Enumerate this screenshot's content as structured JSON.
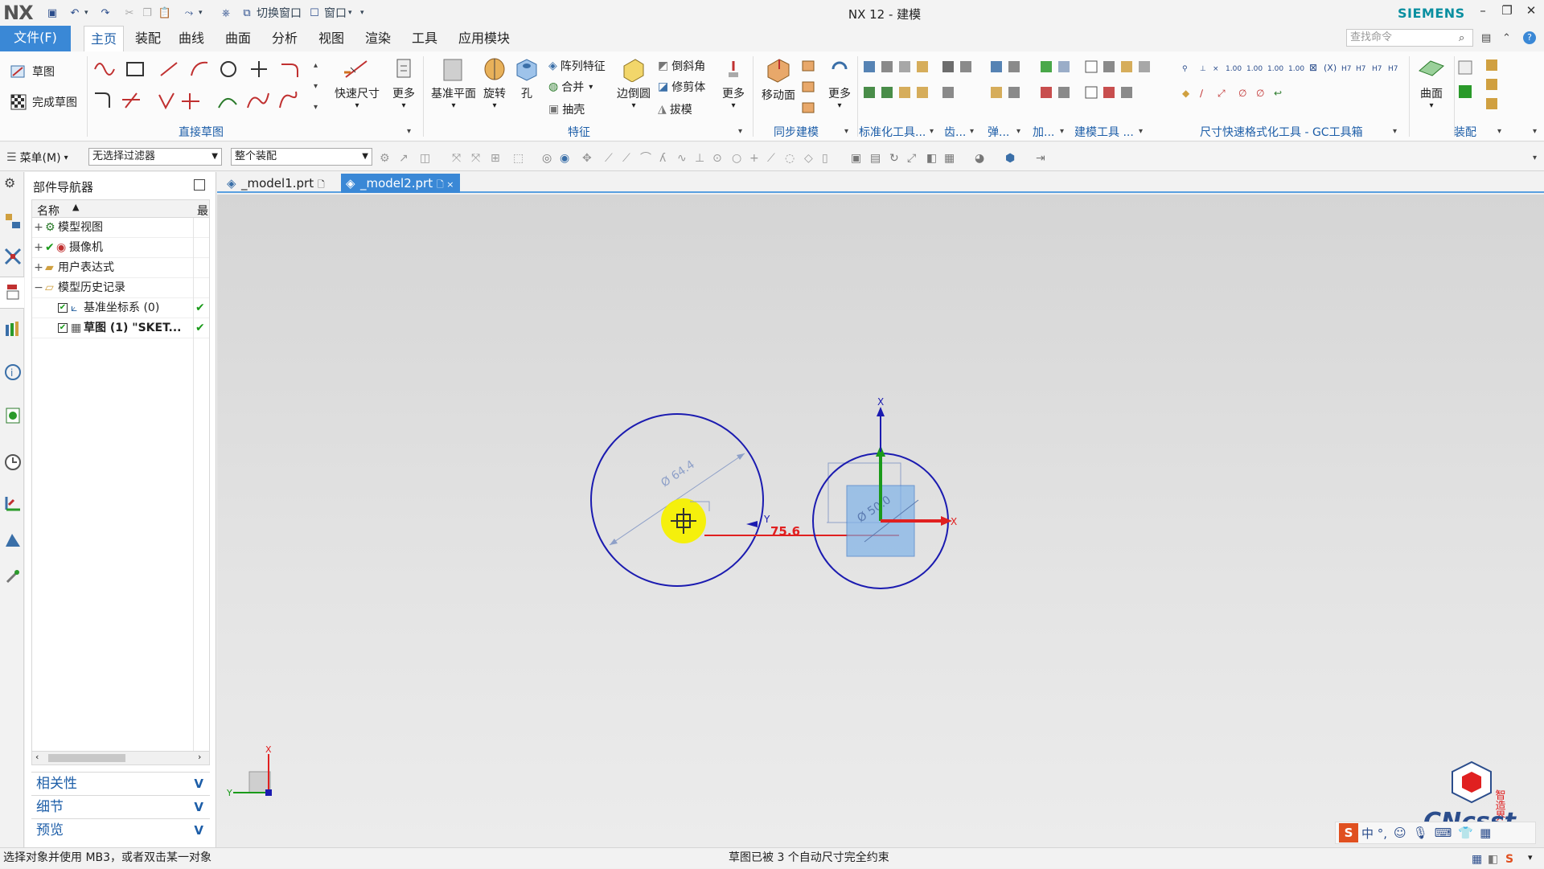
{
  "app": {
    "logo": "NX",
    "window_title": "NX 12 - 建模",
    "brand": "SIEMENS",
    "quick_access": {
      "switch_window": "切换窗口",
      "window": "窗口"
    }
  },
  "menu": {
    "file_label": "文件(F)",
    "tabs": [
      "主页",
      "装配",
      "曲线",
      "曲面",
      "分析",
      "视图",
      "渲染",
      "工具",
      "应用模块"
    ],
    "active_tab": "主页",
    "search_placeholder": "查找命令"
  },
  "ribbon": {
    "sketch": "草图",
    "finish_sketch": "完成草图",
    "quick_dim": "快速尺寸",
    "more": "更多",
    "direct_sketch_group": "直接草图",
    "datum_plane": "基准平面",
    "revolve": "旋转",
    "hole": "孔",
    "pattern_feature": "阵列特征",
    "unite": "合并",
    "shell": "抽壳",
    "edge_blend": "边倒圆",
    "chamfer": "倒斜角",
    "trim_body": "修剪体",
    "draft": "拔模",
    "more2": "更多",
    "feature_group": "特征",
    "move_face": "移动面",
    "more3": "更多",
    "sync_modeling_group": "同步建模",
    "standard_tools_group": "标准化工具...",
    "gear_group": "齿...",
    "spring_group": "弹...",
    "add_group": "加...",
    "modeling_tools_group": "建模工具 ...",
    "dim_format_group": "尺寸快速格式化工具 - GC工具箱",
    "surface": "曲面",
    "assembly_group": "装配"
  },
  "selection_bar": {
    "menu_label": "菜单(M)",
    "filter_value": "无选择过滤器",
    "scope_value": "整个装配"
  },
  "navigator": {
    "title": "部件导航器",
    "col_name": "名称",
    "col_last": "最",
    "rows": [
      {
        "label": "模型视图",
        "expander": "+",
        "checked": false
      },
      {
        "label": "摄像机",
        "expander": "+",
        "checked": false
      },
      {
        "label": "用户表达式",
        "expander": "+",
        "checked": false
      },
      {
        "label": "模型历史记录",
        "expander": "−",
        "checked": false
      },
      {
        "label": "基准坐标系 (0)",
        "expander": "",
        "checked": true
      },
      {
        "label": "草图 (1) \"SKET...",
        "expander": "",
        "checked": true
      }
    ],
    "accordions": [
      "相关性",
      "细节",
      "预览"
    ]
  },
  "file_tabs": [
    {
      "label": "_model1.prt",
      "suffix": "🗋",
      "active": false
    },
    {
      "label": "_model2.prt",
      "suffix": "🗋 ×",
      "active": true
    }
  ],
  "sketch": {
    "dim_large_circle": "Ø 64.4",
    "dim_small_circle": "Ø 50.0",
    "dim_distance": "75.6",
    "axis_x": "X",
    "axis_y": "Y"
  },
  "watermark": {
    "text": "CNcsst",
    "cn": "智造界"
  },
  "ime": {
    "text": "中 °,"
  },
  "status": {
    "left": "选择对象并使用 MB3，或者双击某一对象",
    "center": "草图已被 3 个自动尺寸完全约束"
  },
  "colors": {
    "accent": "#3a88d6",
    "sketch_curve": "#1b1bb0",
    "x_axis": "#e02020",
    "y_axis": "#1a9a1a",
    "highlight": "#f5f000"
  }
}
